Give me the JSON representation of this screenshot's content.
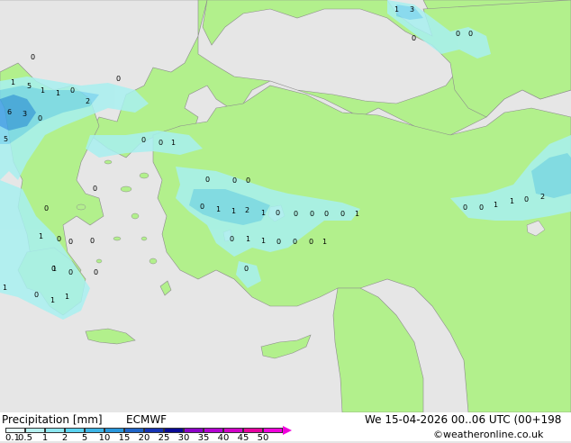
{
  "map": {
    "colors": {
      "sea": "#e6e6e6",
      "land": "#b2f08c",
      "border": "#8c8c8c",
      "precip_light": "#a8f0f0",
      "precip_mid": "#7ad8f0",
      "precip_heavy": "#3ca0e6"
    },
    "precip_values": [
      {
        "v": "1"
      },
      {
        "v": "3"
      },
      {
        "v": "0"
      },
      {
        "v": "0"
      },
      {
        "v": "0"
      },
      {
        "v": "0"
      },
      {
        "v": "1"
      },
      {
        "v": "5"
      },
      {
        "v": "1"
      },
      {
        "v": "1"
      },
      {
        "v": "0"
      },
      {
        "v": "2"
      },
      {
        "v": "0"
      },
      {
        "v": "6"
      },
      {
        "v": "3"
      },
      {
        "v": "0"
      },
      {
        "v": "5"
      },
      {
        "v": "0"
      },
      {
        "v": "0"
      },
      {
        "v": "1"
      },
      {
        "v": "0"
      },
      {
        "v": "0"
      },
      {
        "v": "0"
      },
      {
        "v": "0"
      },
      {
        "v": "0"
      },
      {
        "v": "0"
      },
      {
        "v": "1"
      },
      {
        "v": "1"
      },
      {
        "v": "2"
      },
      {
        "v": "1"
      },
      {
        "v": "0"
      },
      {
        "v": "0"
      },
      {
        "v": "0"
      },
      {
        "v": "0"
      },
      {
        "v": "0"
      },
      {
        "v": "1"
      },
      {
        "v": "0"
      },
      {
        "v": "1"
      },
      {
        "v": "1"
      },
      {
        "v": "0"
      },
      {
        "v": "0"
      },
      {
        "v": "0"
      },
      {
        "v": "1"
      },
      {
        "v": "0"
      },
      {
        "v": "1"
      },
      {
        "v": "0"
      },
      {
        "v": "0"
      },
      {
        "v": "0"
      },
      {
        "v": "1"
      },
      {
        "v": "0"
      },
      {
        "v": "1"
      },
      {
        "v": "0"
      },
      {
        "v": "1"
      },
      {
        "v": "1"
      },
      {
        "v": "0"
      },
      {
        "v": "0"
      },
      {
        "v": "0"
      },
      {
        "v": "0"
      },
      {
        "v": "1"
      },
      {
        "v": "1"
      },
      {
        "v": "0"
      },
      {
        "v": "2"
      }
    ]
  },
  "footer": {
    "title": "Precipitation [mm]",
    "model": "ECMWF",
    "datetime": "We 15-04-2026 00..06 UTC (00+198",
    "credit": "©weatheronline.co.uk",
    "scale": [
      {
        "label": "0.1",
        "color": "#e6fafa"
      },
      {
        "label": "0.5",
        "color": "#b4f0f0"
      },
      {
        "label": "1",
        "color": "#8ce6f0"
      },
      {
        "label": "2",
        "color": "#5ad2f0"
      },
      {
        "label": "5",
        "color": "#3cb4e6"
      },
      {
        "label": "10",
        "color": "#2896dc"
      },
      {
        "label": "15",
        "color": "#1e64c8"
      },
      {
        "label": "20",
        "color": "#1432b4"
      },
      {
        "label": "25",
        "color": "#0a0a96"
      },
      {
        "label": "30",
        "color": "#8c00c8"
      },
      {
        "label": "35",
        "color": "#b400d2"
      },
      {
        "label": "40",
        "color": "#d200c8"
      },
      {
        "label": "45",
        "color": "#e600a0"
      },
      {
        "label": "50",
        "color": "#f000dc"
      }
    ]
  }
}
